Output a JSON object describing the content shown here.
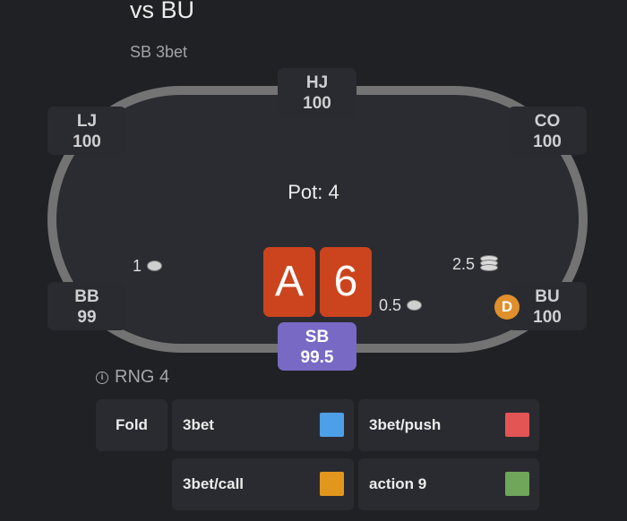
{
  "header": {
    "title": "vs BU",
    "subtitle": "SB 3bet"
  },
  "table": {
    "pot_label": "Pot: 4",
    "seats": {
      "hj": {
        "position": "HJ",
        "stack": "100"
      },
      "lj": {
        "position": "LJ",
        "stack": "100"
      },
      "co": {
        "position": "CO",
        "stack": "100"
      },
      "bb": {
        "position": "BB",
        "stack": "99"
      },
      "bu": {
        "position": "BU",
        "stack": "100"
      },
      "sb": {
        "position": "SB",
        "stack": "99.5"
      }
    },
    "bets": {
      "bb": "1",
      "bu": "2.5",
      "sb": "0.5"
    },
    "dealer_button": "D",
    "hero_cards": [
      "A",
      "6"
    ],
    "colors": {
      "felt_rail": "#737373",
      "felt": "#2b2c31",
      "hero_seat": "#7869c5",
      "card": "#cc441d",
      "dealer": "#df8f2b"
    }
  },
  "rng": {
    "icon": "info-icon",
    "label": "RNG 4"
  },
  "actions": [
    {
      "label": "Fold",
      "color": null
    },
    {
      "label": "3bet",
      "color": "#4c9fe8"
    },
    {
      "label": "3bet/push",
      "color": "#e35454"
    },
    {
      "label": "3bet/call",
      "color": "#e3961c"
    },
    {
      "label": "action 9",
      "color": "#6fa65a"
    }
  ]
}
